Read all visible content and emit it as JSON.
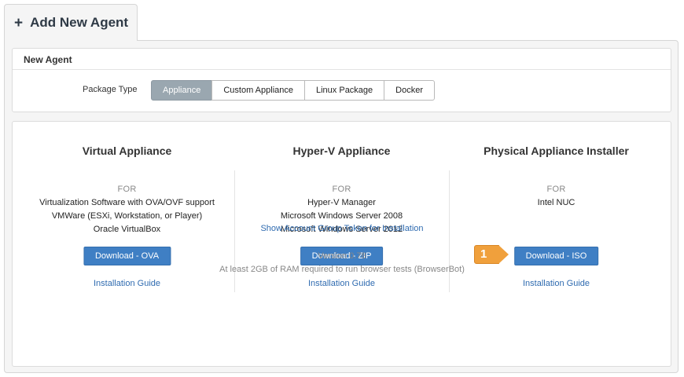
{
  "tab": {
    "icon": "plus-icon",
    "plus": "+",
    "label": "Add New Agent"
  },
  "new_agent": {
    "header": "New Agent",
    "package_type_label": "Package Type",
    "options": [
      "Appliance",
      "Custom Appliance",
      "Linux Package",
      "Docker"
    ],
    "selected": "Appliance"
  },
  "columns": [
    {
      "title": "Virtual Appliance",
      "for_label": "FOR",
      "requirements": [
        "Virtualization Software with OVA/OVF support",
        "VMWare (ESXi, Workstation, or Player)",
        "Oracle VirtualBox"
      ],
      "button": "Download - OVA",
      "guide": "Installation Guide"
    },
    {
      "title": "Hyper-V Appliance",
      "for_label": "FOR",
      "requirements": [
        "Hyper-V Manager",
        "Microsoft Windows Server 2008",
        "Microsoft Windows Server 2012"
      ],
      "button": "Download - ZIP",
      "guide": "Installation Guide"
    },
    {
      "title": "Physical Appliance Installer",
      "for_label": "FOR",
      "requirements": [
        "Intel NUC"
      ],
      "button": "Download - ISO",
      "guide": "Installation Guide"
    }
  ],
  "callout": {
    "number": "1",
    "color": "#f0a03c"
  },
  "token_link": "Show Account Group Token for Installation",
  "version": "Version 0.78",
  "ram_note": "At least 2GB of RAM required to run browser tests (BrowserBot)",
  "colors": {
    "primary_button": "#3f7fc4",
    "link": "#2f6bb0",
    "selected_segment": "#9aa7b0"
  }
}
